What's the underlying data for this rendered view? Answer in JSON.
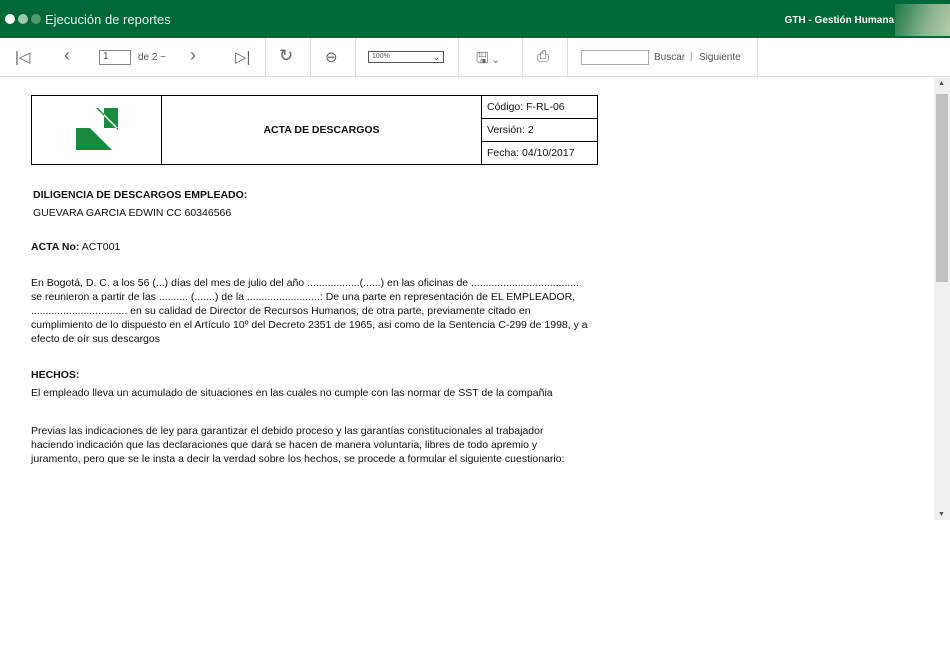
{
  "header": {
    "title": "Ejecución de reportes",
    "brand": "GTH - Gestión Humana"
  },
  "toolbar": {
    "page_value": "1",
    "page_total": "de 2 ~",
    "zoom": "100%",
    "search_value": "",
    "search_label": "Buscar",
    "next_label": "Siguiente",
    "icons": [
      "first-page-icon",
      "prev-page-icon",
      "next-page-icon",
      "last-page-icon",
      "refresh-icon",
      "back-icon",
      "save-icon",
      "print-icon"
    ]
  },
  "doc": {
    "header_title": "ACTA DE DESCARGOS",
    "code": "Código: F-RL-06",
    "version": "Versión: 2",
    "date": "Fecha: 04/10/2017",
    "diligence_heading": "DILIGENCIA DE DESCARGOS EMPLEADO:",
    "employee": "GUEVARA GARCIA  EDWIN  CC 60346566",
    "acta_label": "ACTA No:",
    "acta_value": "ACT001",
    "para1": "En Bogotá, D. C. a los 56  (...) días  del mes de julio del año ..................(......)  en las oficinas de  .....................................  se reunieron a partir de las .......... (.......) de la .........................: De una parte en representación de EL EMPLEADOR, ................................. en su calidad de Director de Recursos Humanos, de otra parte, previamente citado en cumplimiento de lo dispuesto en el Artículo 10º del Decreto 2351 de 1965, asi como de la Sentencia C-299 de 1998, y a efecto de oír sus descargos",
    "hechos_heading": "HECHOS:",
    "hechos": "El empleado lleva un acumulado de situaciones en las cuales no cumple con las normar de SST de la compañia",
    "para2": "Previas las indicaciones de ley para garantizar el debido proceso y las garantías constitucionales al trabajador haciendo indicación que las declaraciones que dará se hacen de manera voluntaria, libres de todo apremio y juramento, pero que se le insta a decir la verdad sobre los hechos, se procede a formular el siguiente cuestionario:"
  },
  "colors": {
    "header": "#006837",
    "logo": "#1a8a3e"
  }
}
